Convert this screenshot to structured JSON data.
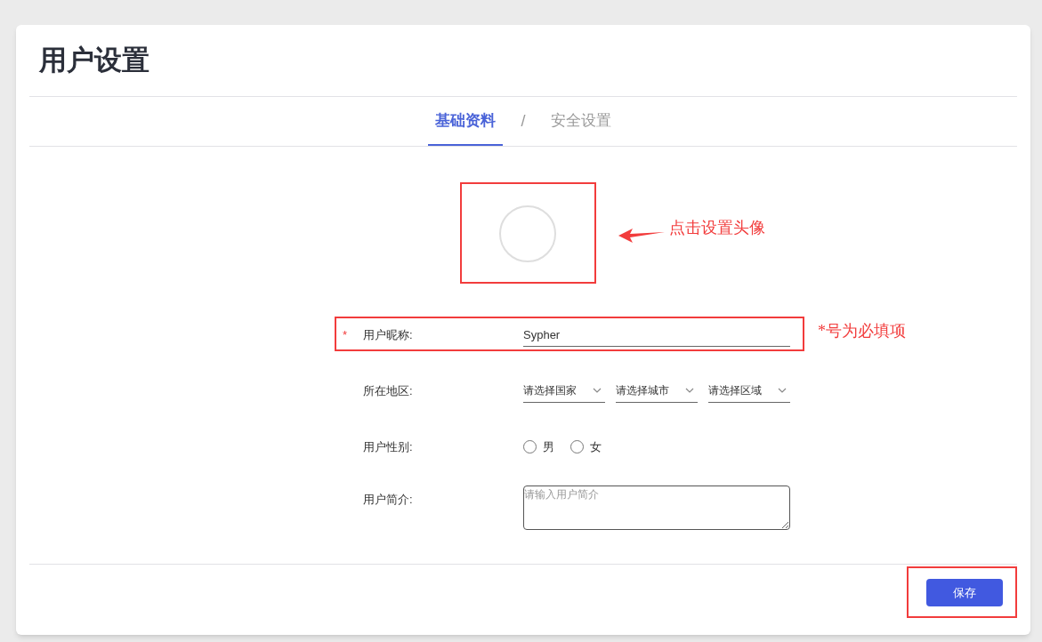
{
  "page": {
    "title": "用户设置"
  },
  "tabs": [
    {
      "label": "基础资料",
      "selected": true
    },
    {
      "label": "安全设置",
      "selected": false
    }
  ],
  "tab_separator": "/",
  "form": [
    {
      "kind": "text",
      "required_mark": "*",
      "label": "用户昵称:",
      "value": "Sypher"
    },
    {
      "kind": "selects",
      "label": "所在地区:",
      "selects": [
        {
          "placeholder": "请选择国家"
        },
        {
          "placeholder": "请选择城市"
        },
        {
          "placeholder": "请选择区域"
        }
      ]
    },
    {
      "kind": "radio",
      "label": "用户性别:",
      "choices": [
        {
          "label": "男",
          "selected": false
        },
        {
          "label": "女",
          "selected": false
        }
      ]
    },
    {
      "kind": "textarea",
      "label": "用户简介:",
      "placeholder": "请输入用户简介"
    }
  ],
  "annotations": {
    "avatar_note": "点击设置头像",
    "required_note": "*号为必填项"
  },
  "save_button": "保存"
}
